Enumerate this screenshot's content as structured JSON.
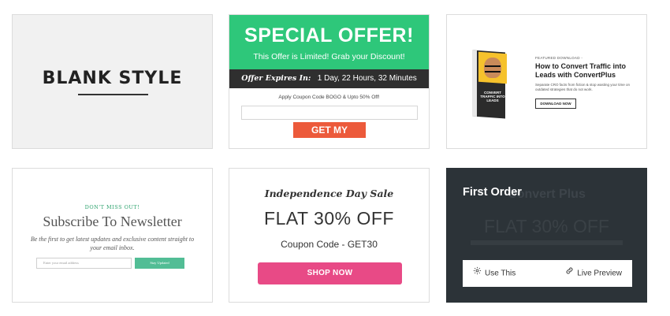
{
  "templates": [
    {
      "id": "blank",
      "title": "BLANK STYLE"
    },
    {
      "id": "special-offer",
      "title": "SPECIAL OFFER!",
      "subtitle": "This Offer is Limited! Grab your Discount!",
      "expires_label": "Offer Expires In:",
      "expires_value": "1 Day, 22 Hours, 32 Minutes",
      "apply_text": "Apply Coupon Code BOGO & Upto 50% Off!",
      "button_label": "GET MY OFFER!"
    },
    {
      "id": "featured-download",
      "kicker": "FEATURED DOWNLOAD -",
      "title": "How to Convert Traffic into Leads with ConvertPlus",
      "description": "Separate CRO facts from fiction & stop wasting your time on outdated strategies that do not work.",
      "button_label": "DOWNLOAD NOW",
      "box_label": "CONVERT TRAFFIC INTO LEADS"
    },
    {
      "id": "newsletter",
      "kicker": "DON'T MISS OUT!",
      "title": "Subscribe To Newsletter",
      "description": "Be the first to get latest updates and exclusive content straight to your email inbox.",
      "input_placeholder": "Enter your email address",
      "button_label": "Stay Updated"
    },
    {
      "id": "independence-day",
      "script_title": "Independence Day Sale",
      "headline": "FLAT 30% OFF",
      "coupon": "Coupon Code - GET30",
      "button_label": "SHOP NOW",
      "accent_color": "#e84a86"
    },
    {
      "id": "first-order",
      "overlay_title": "First Order",
      "ghost_title": "Convert Plus",
      "ghost_headline": "FLAT 30% OFF",
      "use_label": "Use This",
      "preview_label": "Live Preview",
      "use_icon": "gear-icon",
      "preview_icon": "link-icon"
    }
  ],
  "colors": {
    "special_offer_green": "#2ec77a",
    "offer_button": "#ec5a3b",
    "newsletter_green": "#52bd95",
    "dark_overlay": "#2c3338"
  }
}
